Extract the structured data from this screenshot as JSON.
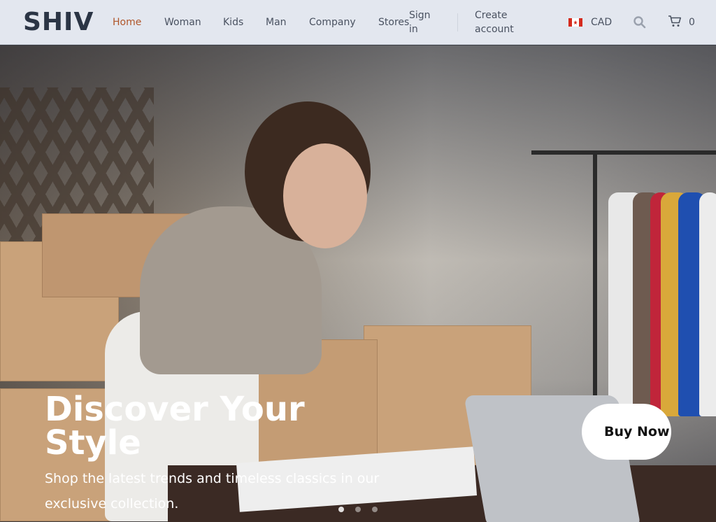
{
  "header": {
    "logo": "SHIV",
    "nav": [
      {
        "label": "Home",
        "active": true
      },
      {
        "label": "Woman"
      },
      {
        "label": "Kids"
      },
      {
        "label": "Man"
      },
      {
        "label": "Company"
      },
      {
        "label": "Stores"
      }
    ],
    "sign_in": "Sign in",
    "create_account": "Create account",
    "currency": {
      "code": "CAD",
      "flag": "canada-flag-icon"
    },
    "search_icon": "search-icon",
    "cart": {
      "icon": "cart-icon",
      "count": "0"
    }
  },
  "hero": {
    "title": "Discover Your Style",
    "subtitle": "Shop the latest trends and timeless classics in our exclusive collection.",
    "cta": "Buy Now",
    "slides": 3,
    "active_slide": 1
  },
  "colors": {
    "header_bg": "#e3e7ef",
    "logo": "#2b3545",
    "nav_text": "#4a5261",
    "active_nav": "#b0562a",
    "cta_bg": "#ffffff"
  }
}
